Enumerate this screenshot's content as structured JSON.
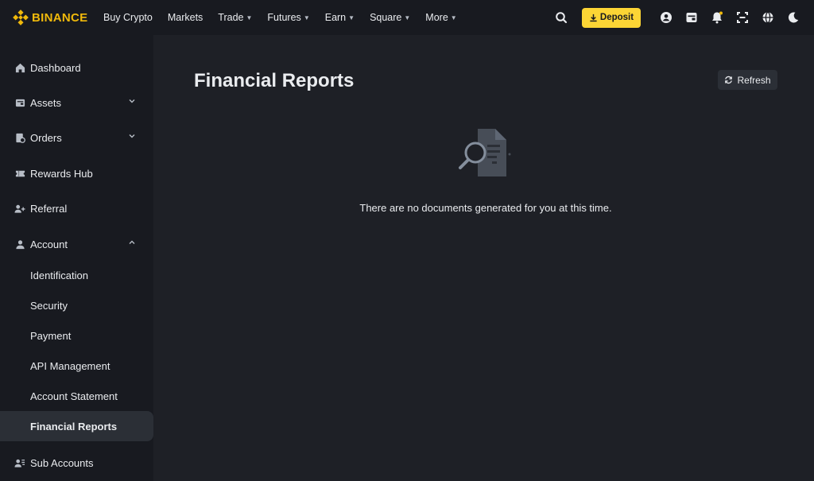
{
  "brand": {
    "name": "BINANCE",
    "color": "#F0B90B"
  },
  "nav": [
    {
      "label": "Buy Crypto",
      "dropdown": false
    },
    {
      "label": "Markets",
      "dropdown": false
    },
    {
      "label": "Trade",
      "dropdown": true
    },
    {
      "label": "Futures",
      "dropdown": true
    },
    {
      "label": "Earn",
      "dropdown": true
    },
    {
      "label": "Square",
      "dropdown": true
    },
    {
      "label": "More",
      "dropdown": true
    }
  ],
  "header": {
    "deposit_label": "Deposit",
    "icons": [
      "search-icon",
      "user-icon",
      "wallet-icon",
      "bell-icon",
      "scan-icon",
      "globe-icon",
      "moon-icon"
    ]
  },
  "sidebar": {
    "items": [
      {
        "label": "Dashboard",
        "icon": "home-icon"
      },
      {
        "label": "Assets",
        "icon": "wallet-icon",
        "expandable": true,
        "expanded": false
      },
      {
        "label": "Orders",
        "icon": "orders-icon",
        "expandable": true,
        "expanded": false
      },
      {
        "label": "Rewards Hub",
        "icon": "ticket-icon"
      },
      {
        "label": "Referral",
        "icon": "user-plus-icon"
      },
      {
        "label": "Account",
        "icon": "person-icon",
        "expandable": true,
        "expanded": true
      }
    ],
    "account_sub": [
      {
        "label": "Identification",
        "active": false
      },
      {
        "label": "Security",
        "active": false
      },
      {
        "label": "Payment",
        "active": false
      },
      {
        "label": "API Management",
        "active": false
      },
      {
        "label": "Account Statement",
        "active": false
      },
      {
        "label": "Financial Reports",
        "active": true
      }
    ],
    "bottom_item": {
      "label": "Sub Accounts",
      "icon": "users-icon"
    }
  },
  "main": {
    "title": "Financial Reports",
    "refresh_label": "Refresh",
    "empty_message": "There are no documents generated for you at this time."
  },
  "colors": {
    "accent": "#FCD535",
    "background": "#181A20",
    "panel": "#1E2026",
    "active_item": "#2B2F36"
  }
}
